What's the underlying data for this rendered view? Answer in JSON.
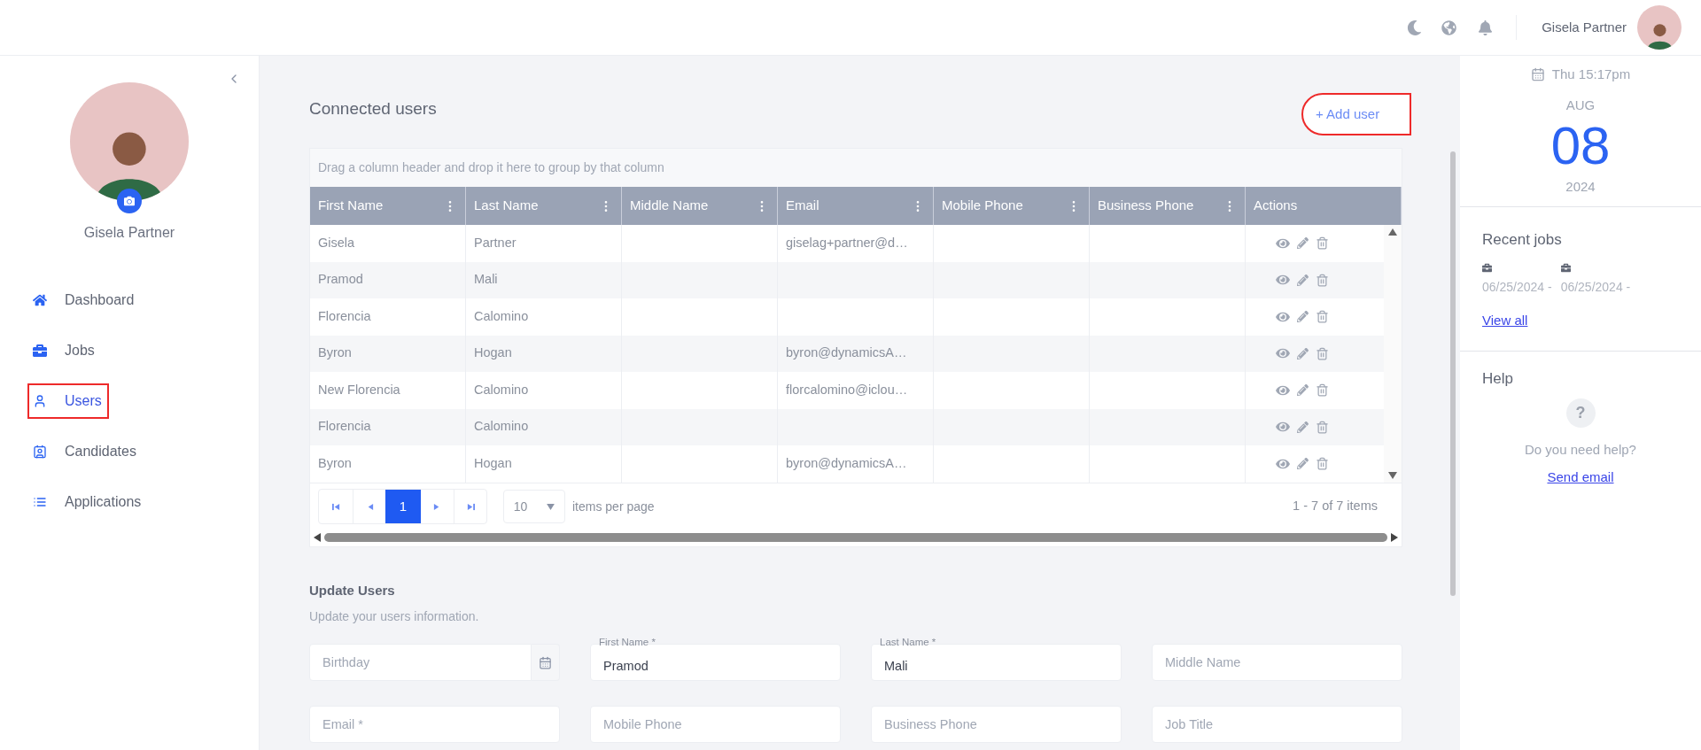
{
  "topbar": {
    "user_name": "Gisela Partner"
  },
  "sidebar": {
    "profile_name": "Gisela Partner",
    "items": [
      {
        "label": "Dashboard",
        "selected": false,
        "highlighted": false
      },
      {
        "label": "Jobs",
        "selected": false,
        "highlighted": false
      },
      {
        "label": "Users",
        "selected": true,
        "highlighted": true
      },
      {
        "label": "Candidates",
        "selected": false,
        "highlighted": false
      },
      {
        "label": "Applications",
        "selected": false,
        "highlighted": false
      }
    ]
  },
  "main": {
    "title": "Connected users",
    "add_button": {
      "label": "+ Add user",
      "highlighted": true
    },
    "table": {
      "group_hint": "Drag a column header and drop it here to group by that column",
      "columns": [
        {
          "label": "First Name",
          "menu": true
        },
        {
          "label": "Last Name",
          "menu": true
        },
        {
          "label": "Middle Name",
          "menu": true
        },
        {
          "label": "Email",
          "menu": true
        },
        {
          "label": "Mobile Phone",
          "menu": true
        },
        {
          "label": "Business Phone",
          "menu": true
        },
        {
          "label": "Actions",
          "menu": false
        }
      ],
      "rows": [
        [
          "Gisela",
          "Partner",
          "",
          "giselag+partner@d…",
          "",
          ""
        ],
        [
          "Pramod",
          "Mali",
          "",
          "",
          "",
          ""
        ],
        [
          "Florencia",
          "Calomino",
          "",
          "",
          "",
          ""
        ],
        [
          "Byron",
          "Hogan",
          "",
          "byron@dynamicsA…",
          "",
          ""
        ],
        [
          "New Florencia",
          "Calomino",
          "",
          "florcalomino@iclou…",
          "",
          ""
        ],
        [
          "Florencia",
          "Calomino",
          "",
          "",
          "",
          ""
        ],
        [
          "Byron",
          "Hogan",
          "",
          "byron@dynamicsA…",
          "",
          ""
        ]
      ],
      "pager": {
        "pages": [
          {
            "label": "1",
            "selected": true
          }
        ],
        "page_size": "10",
        "page_size_label": "items per page",
        "summary": "1 - 7 of 7 items"
      }
    },
    "form": {
      "title": "Update Users",
      "subtitle": "Update your users information.",
      "fields": [
        {
          "kind": "date",
          "placeholder": "Birthday"
        },
        {
          "kind": "text",
          "label": "First Name *",
          "value": "Pramod"
        },
        {
          "kind": "text",
          "label": "Last Name *",
          "value": "Mali"
        },
        {
          "kind": "text",
          "placeholder": "Middle Name"
        },
        {
          "kind": "text",
          "placeholder": "Email *"
        },
        {
          "kind": "text",
          "placeholder": "Mobile Phone"
        },
        {
          "kind": "text",
          "placeholder": "Business Phone"
        },
        {
          "kind": "text",
          "placeholder": "Job Title"
        }
      ]
    }
  },
  "right_panel": {
    "time": "Thu 15:17pm",
    "month": "AUG",
    "day": "08",
    "year": "2024",
    "recent_jobs": {
      "title": "Recent jobs",
      "jobs": [
        "06/25/2024 -",
        "06/25/2024 -"
      ],
      "view_all": "View all"
    },
    "help": {
      "title": "Help",
      "icon_text": "?",
      "text": "Do you need help?",
      "link": "Send email"
    }
  }
}
